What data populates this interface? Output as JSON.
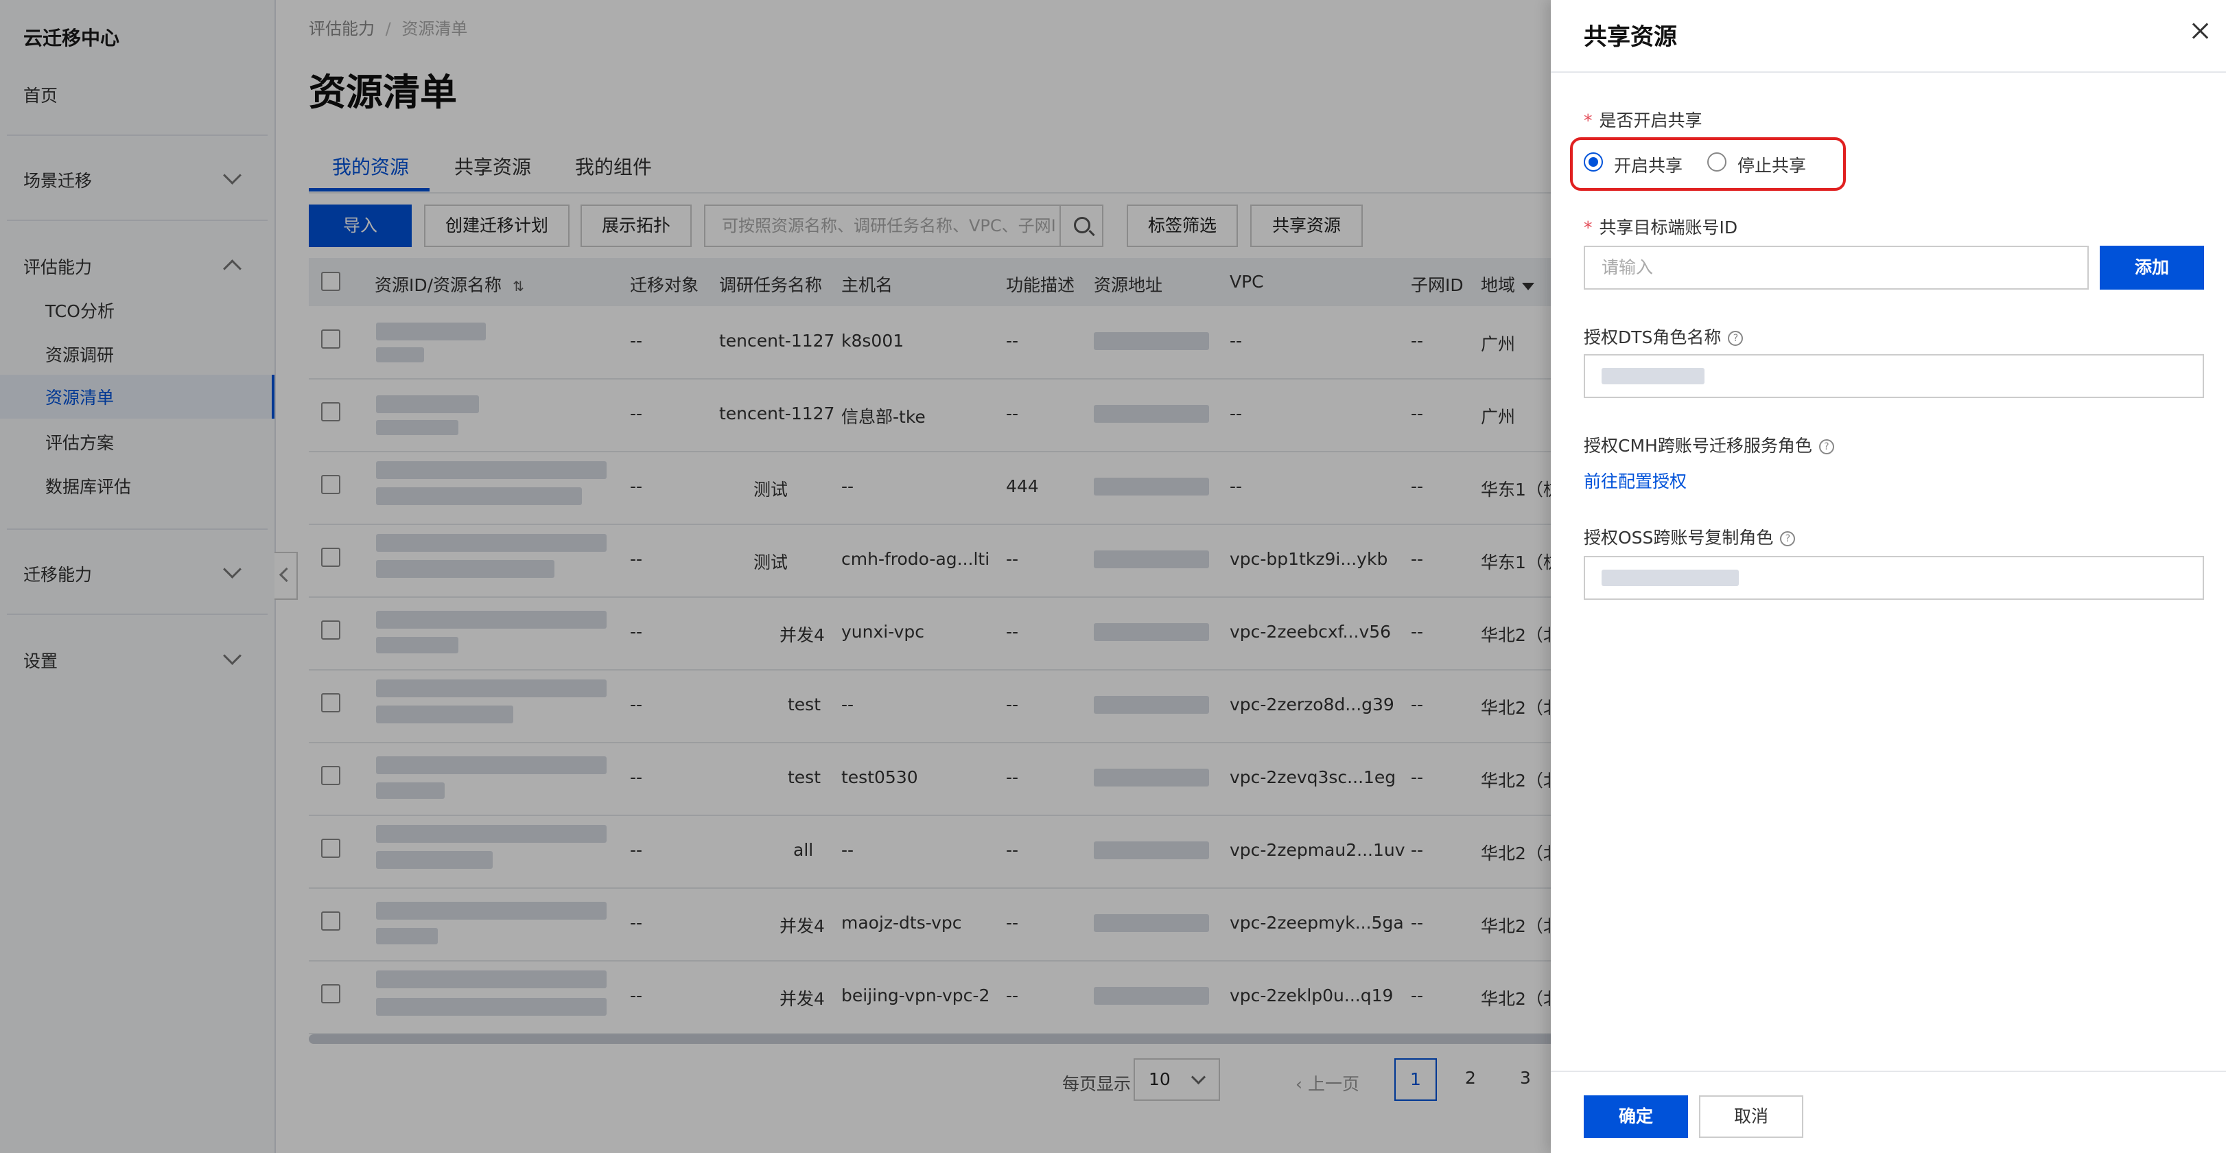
{
  "sidebar": {
    "title": "云迁移中心",
    "home": "首页",
    "scene_migration": "场景迁移",
    "evaluation": "评估能力",
    "eval_items": [
      "TCO分析",
      "资源调研",
      "资源清单",
      "评估方案",
      "数据库评估"
    ],
    "migration_capability": "迁移能力",
    "settings": "设置"
  },
  "breadcrumb": {
    "parent": "评估能力",
    "separator": "/",
    "current": "资源清单"
  },
  "page_title": "资源清单",
  "tabs": [
    "我的资源",
    "共享资源",
    "我的组件"
  ],
  "toolbar": {
    "import": "导入",
    "create_plan": "创建迁移计划",
    "show_topology": "展示拓扑",
    "search_placeholder": "可按照资源名称、调研任务名称、VPC、子网I",
    "tag_filter": "标签筛选",
    "share_resources": "共享资源"
  },
  "table": {
    "headers": [
      "资源ID/资源名称",
      "迁移对象",
      "调研任务名称",
      "主机名",
      "功能描述",
      "资源地址",
      "VPC",
      "子网ID",
      "地域"
    ],
    "sort_icon": "⇅",
    "rows": [
      {
        "migration": "--",
        "task": "tencent-1127",
        "host": "k8s001",
        "desc": "--",
        "vpc": "--",
        "subnet": "--",
        "region": "广州"
      },
      {
        "migration": "--",
        "task": "tencent-1127",
        "host": "信息部-tke",
        "desc": "--",
        "vpc": "--",
        "subnet": "--",
        "region": "广州"
      },
      {
        "migration": "--",
        "task": "测试",
        "host": "--",
        "desc": "444",
        "vpc": "--",
        "subnet": "--",
        "region": "华东1（杭"
      },
      {
        "migration": "--",
        "task": "测试",
        "host": "cmh-frodo-ag...lti",
        "desc": "--",
        "vpc": "vpc-bp1tkz9i...ykb",
        "subnet": "--",
        "region": "华东1（杭"
      },
      {
        "migration": "--",
        "task": "并发4",
        "host": "yunxi-vpc",
        "desc": "--",
        "vpc": "vpc-2zeebcxf...v56",
        "subnet": "--",
        "region": "华北2（北"
      },
      {
        "migration": "--",
        "task": "test",
        "host": "--",
        "desc": "--",
        "vpc": "vpc-2zerzo8d...g39",
        "subnet": "--",
        "region": "华北2（北"
      },
      {
        "migration": "--",
        "task": "test",
        "host": "test0530",
        "desc": "--",
        "vpc": "vpc-2zevq3sc...1eg",
        "subnet": "--",
        "region": "华北2（北"
      },
      {
        "migration": "--",
        "task": "all",
        "host": "--",
        "desc": "--",
        "vpc": "vpc-2zepmau2...1uv",
        "subnet": "--",
        "region": "华北2（北"
      },
      {
        "migration": "--",
        "task": "并发4",
        "host": "maojz-dts-vpc",
        "desc": "--",
        "vpc": "vpc-2zeepmyk...5ga",
        "subnet": "--",
        "region": "华北2（北"
      },
      {
        "migration": "--",
        "task": "并发4",
        "host": "beijing-vpn-vpc-2",
        "desc": "--",
        "vpc": "vpc-2zeklp0u...q19",
        "subnet": "--",
        "region": "华北2（北"
      }
    ]
  },
  "pagination": {
    "per_page_label": "每页显示",
    "per_page": "10",
    "prev": "上一页",
    "pages": [
      "1",
      "2",
      "3"
    ]
  },
  "drawer": {
    "title": "共享资源",
    "enable_share_label": "是否开启共享",
    "radio_on": "开启共享",
    "radio_off": "停止共享",
    "target_account_label": "共享目标端账号ID",
    "target_placeholder": "请输入",
    "add_button": "添加",
    "dts_role_label": "授权DTS角色名称",
    "cmh_role_label": "授权CMH跨账号迁移服务角色",
    "config_link": "前往配置授权",
    "oss_role_label": "授权OSS跨账号复制角色",
    "required_mark": "*",
    "help_mark": "?",
    "ok": "确定",
    "cancel": "取消"
  },
  "colors": {
    "primary": "#0052d9",
    "highlight_border": "#e02020"
  },
  "icons": [
    "chevron-down-icon",
    "chevron-up-icon",
    "search-icon",
    "close-icon",
    "help-icon",
    "sort-icon",
    "caret-down-icon",
    "chevron-left-icon"
  ]
}
